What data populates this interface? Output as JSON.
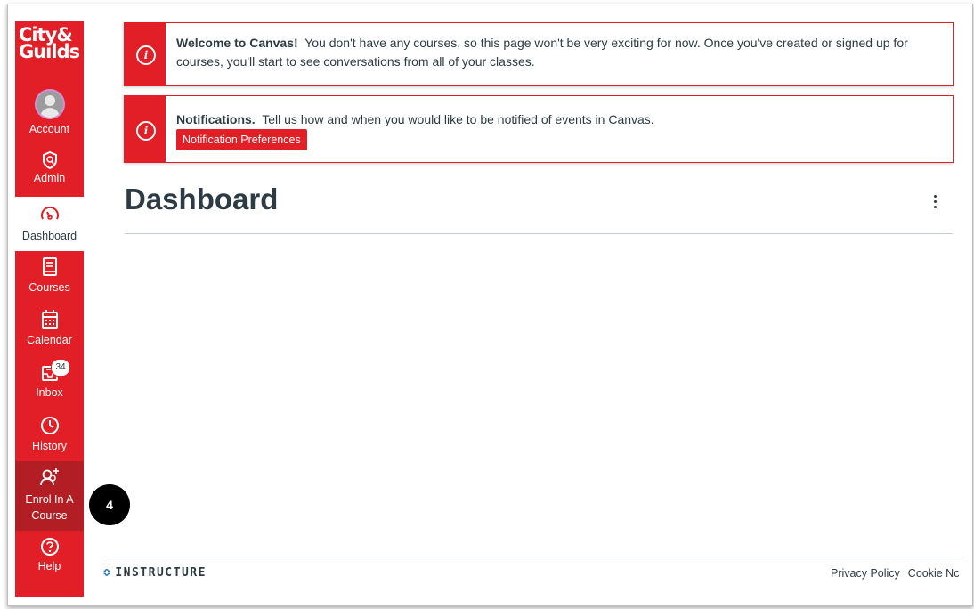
{
  "nav": {
    "logo_line1": "City&",
    "logo_line2": "Guilds",
    "items": [
      {
        "label": "Account",
        "icon": "avatar"
      },
      {
        "label": "Admin",
        "icon": "shield-icon"
      },
      {
        "label": "Dashboard",
        "icon": "dashboard-gauge-icon"
      },
      {
        "label": "Courses",
        "icon": "book-icon"
      },
      {
        "label": "Calendar",
        "icon": "calendar-icon"
      },
      {
        "label": "Inbox",
        "icon": "inbox-icon",
        "badge": "34"
      },
      {
        "label": "History",
        "icon": "clock-icon"
      },
      {
        "label": "Enrol In A Course",
        "icon": "add-user-icon"
      },
      {
        "label": "Help",
        "icon": "help-icon"
      }
    ]
  },
  "alerts": {
    "welcome": {
      "title": "Welcome to Canvas!",
      "text": "You don't have any courses, so this page won't be very exciting for now. Once you've created or signed up for courses, you'll start to see conversations from all of your classes."
    },
    "notifications": {
      "title": "Notifications.",
      "text": "Tell us how and when you would like to be notified of events in Canvas.",
      "button": "Notification Preferences"
    }
  },
  "main": {
    "title": "Dashboard"
  },
  "footer": {
    "brand": "INSTRUCTURE",
    "links": [
      "Privacy Policy",
      "Cookie Nc"
    ]
  },
  "callout": {
    "step": "4"
  },
  "colors": {
    "brand": "#e21f26",
    "enrol_active": "#b21e23",
    "text": "#2d3b45"
  }
}
